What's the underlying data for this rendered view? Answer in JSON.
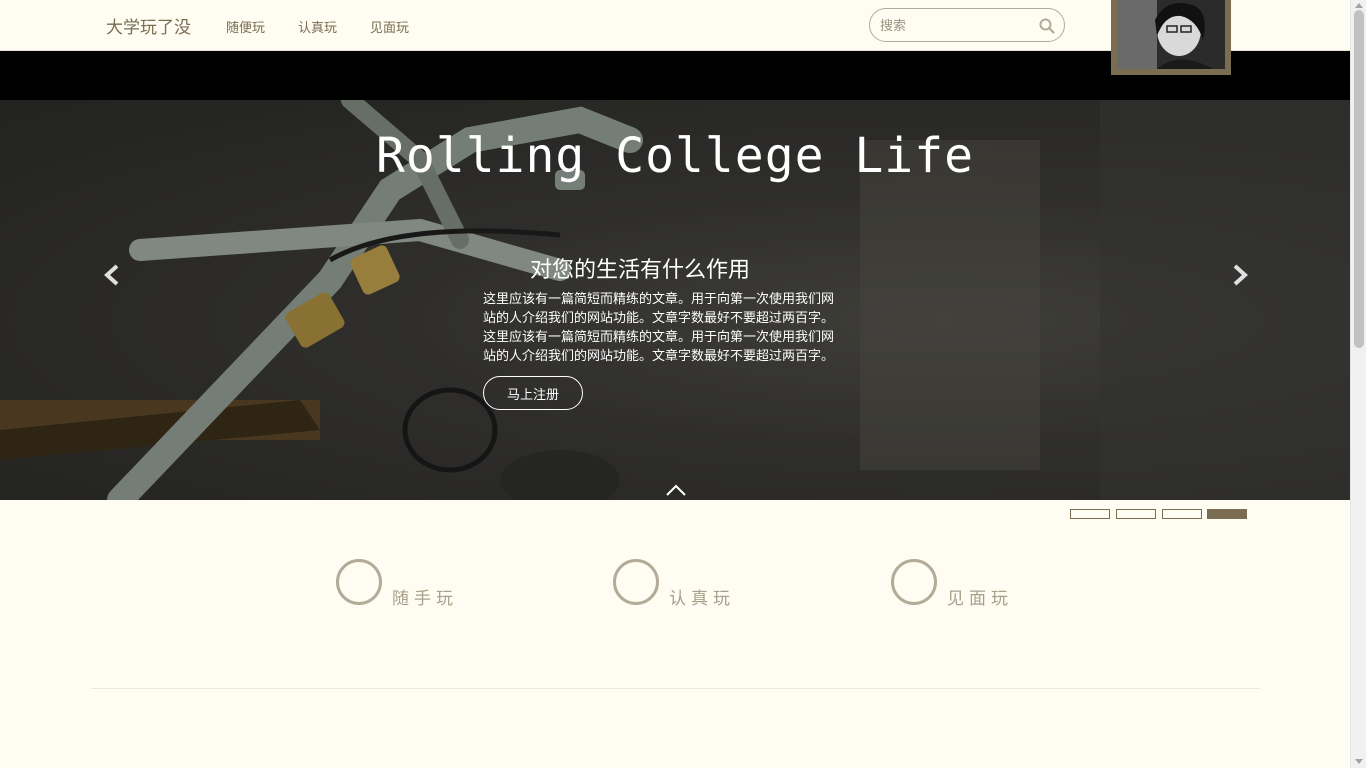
{
  "navbar": {
    "brand": "大学玩了没",
    "links": [
      "随便玩",
      "认真玩",
      "见面玩"
    ],
    "search_placeholder": "搜索"
  },
  "hero": {
    "title": "Rolling College Life",
    "subtitle": "对您的生活有什么作用",
    "body_lines": [
      "这里应该有一篇简短而精练的文章。用于向第一次使用我们网",
      "站的人介绍我们的网站功能。文章字数最好不要超过两百字。",
      "这里应该有一篇简短而精练的文章。用于向第一次使用我们网",
      "站的人介绍我们的网站功能。文章字数最好不要超过两百字。"
    ],
    "signup_label": "马上注册"
  },
  "carousel": {
    "slide_count": 4,
    "active_index": 3
  },
  "features": [
    {
      "label": "随手玩"
    },
    {
      "label": "认真玩"
    },
    {
      "label": "见面玩"
    }
  ],
  "colors": {
    "accent": "#7a6d52",
    "background": "#fffcf2",
    "muted": "#b2ab98"
  },
  "icons": [
    "search-icon",
    "chevron-left-icon",
    "chevron-right-icon",
    "chevron-up-icon"
  ]
}
